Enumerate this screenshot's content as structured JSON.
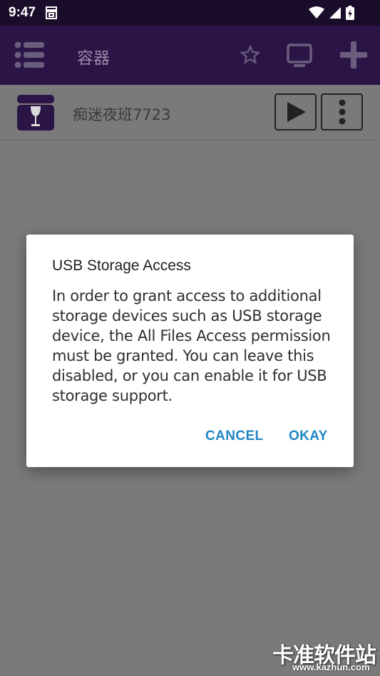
{
  "status_bar": {
    "time": "9:47"
  },
  "toolbar": {
    "title": "容器",
    "icons": [
      "menu-icon",
      "star-icon",
      "monitor-icon",
      "add-icon"
    ]
  },
  "container_list": [
    {
      "name": "痴迷夜班7723"
    }
  ],
  "dialog": {
    "title": "USB Storage Access",
    "message": "In order to grant access to additional storage devices such as USB storage device, the All Files Access permission must be granted. You can leave this disabled, or you can enable it for USB storage support.",
    "cancel_label": "CANCEL",
    "okay_label": "OKAY",
    "accent_color": "#1f86c4"
  },
  "watermark": {
    "text": "卡准软件站",
    "url": "www.kazhun.com"
  },
  "colors": {
    "toolbar_bg": "#2b1446",
    "status_bar_bg": "#1a0d2a",
    "scrim_bg": "#7a7a7a"
  }
}
